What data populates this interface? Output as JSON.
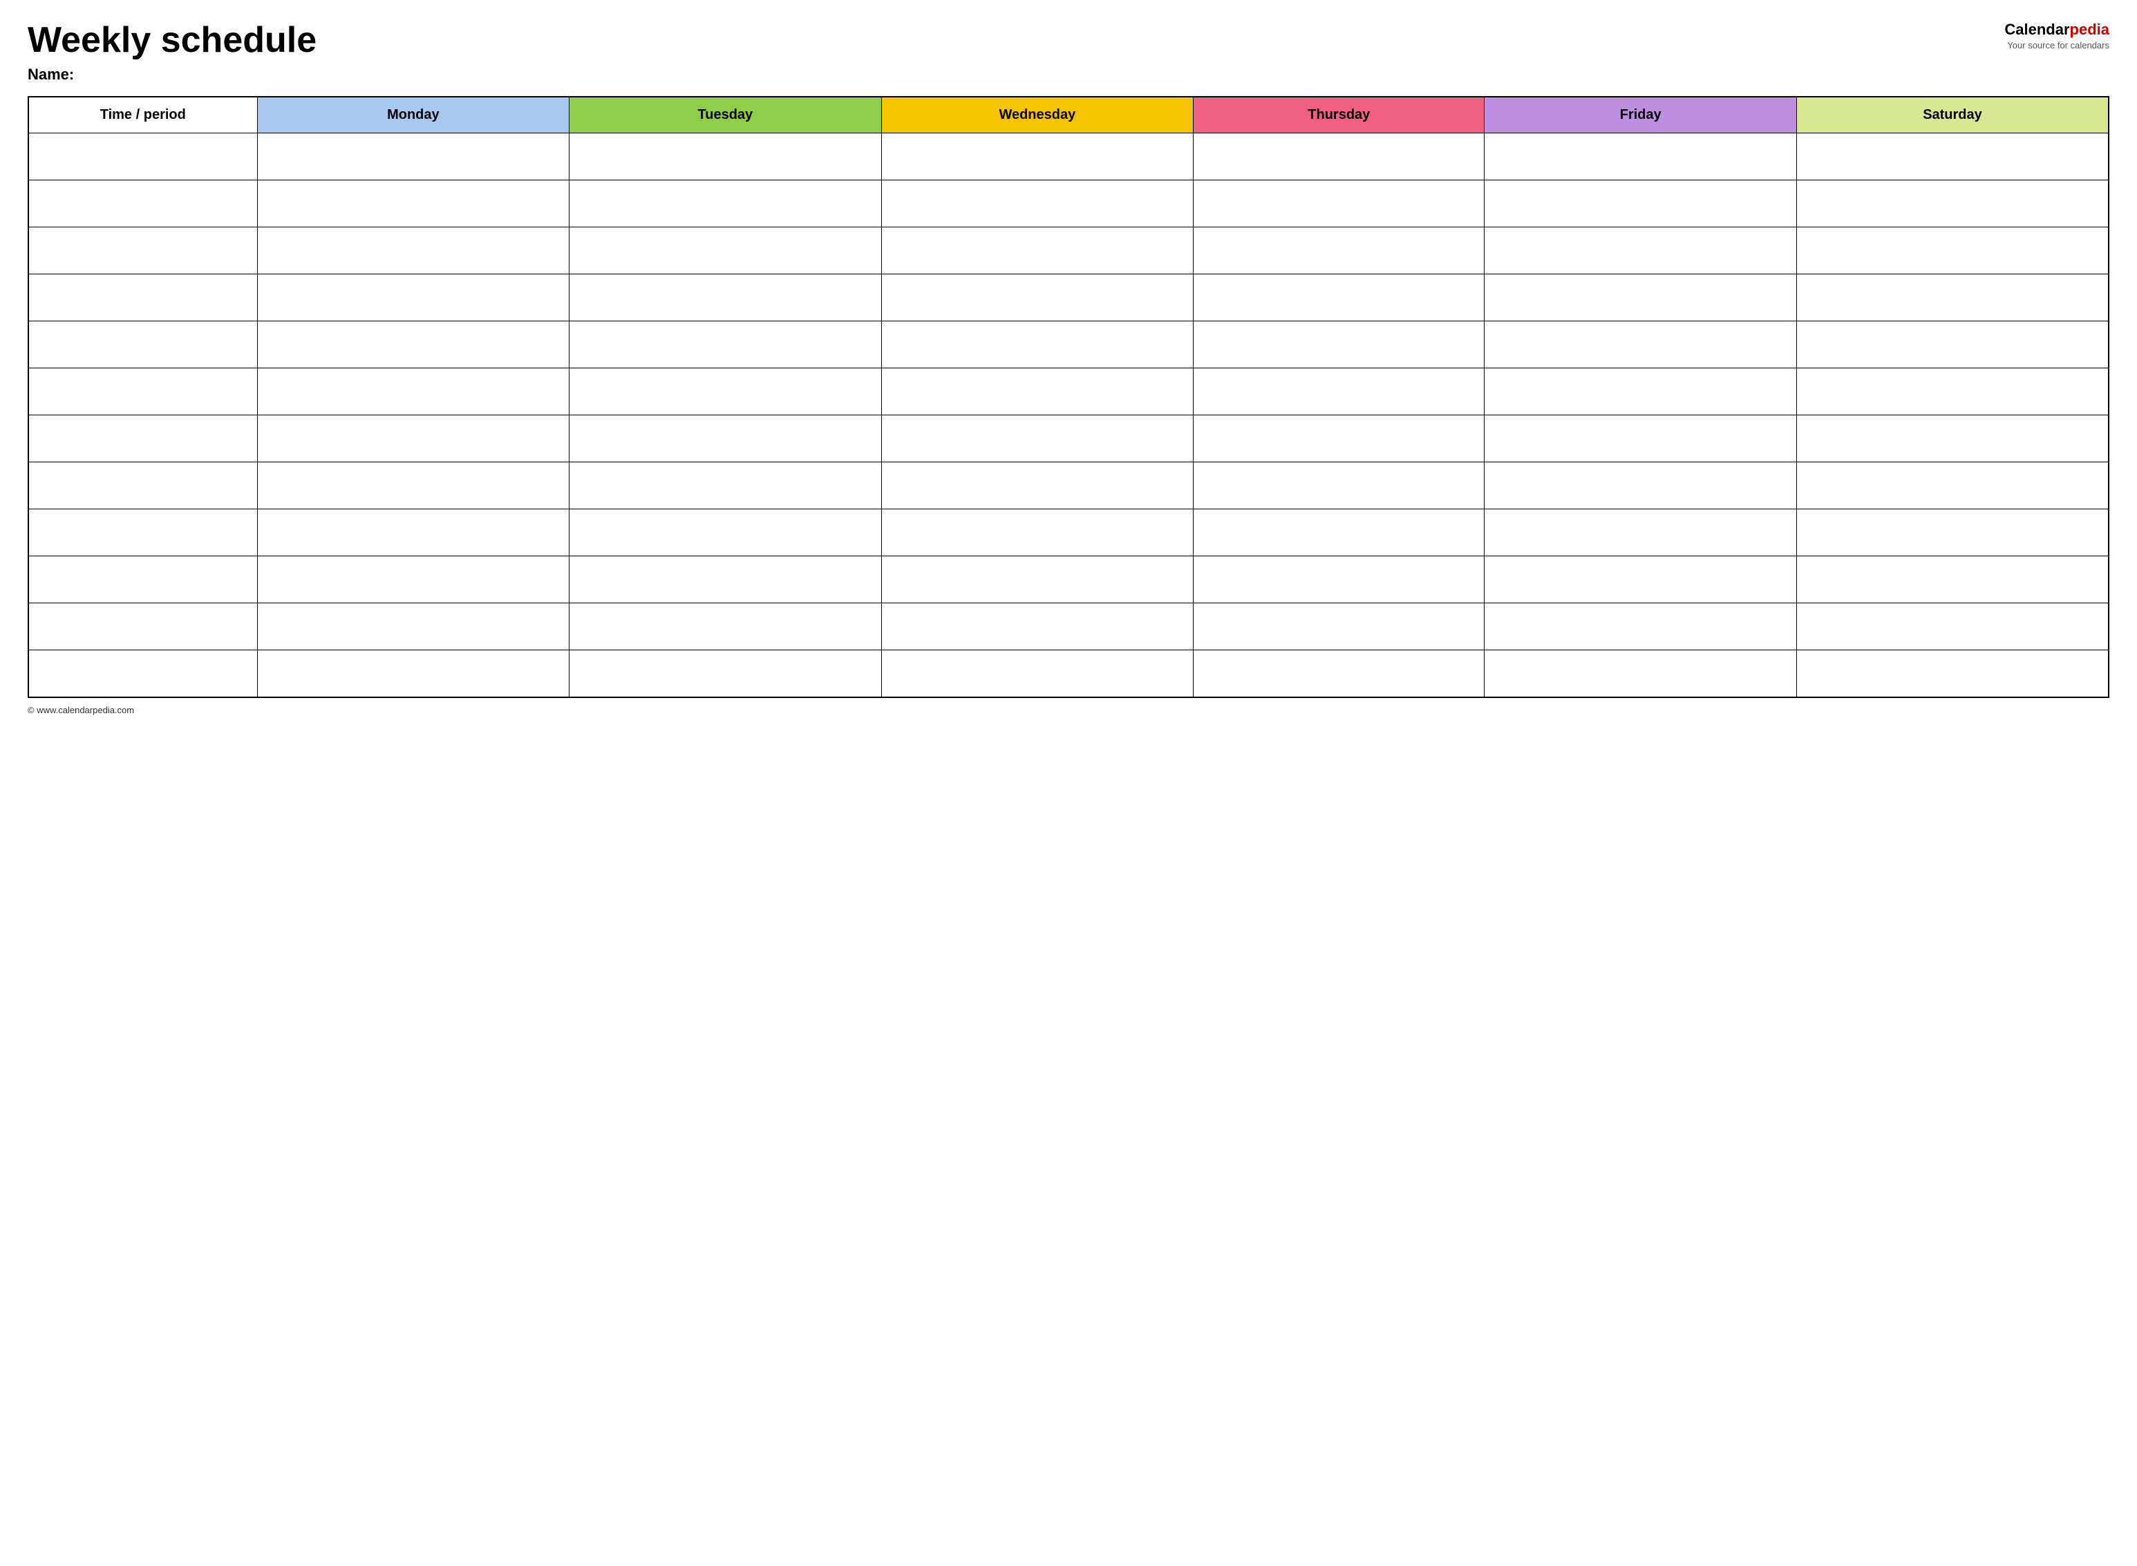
{
  "header": {
    "title": "Weekly schedule",
    "name_label": "Name:",
    "logo": {
      "calendar_part": "Calendar",
      "pedia_part": "pedia",
      "subtitle": "Your source for calendars"
    }
  },
  "table": {
    "columns": [
      {
        "key": "time",
        "label": "Time / period",
        "color": "#ffffff"
      },
      {
        "key": "monday",
        "label": "Monday",
        "color": "#a8c8f0"
      },
      {
        "key": "tuesday",
        "label": "Tuesday",
        "color": "#8fcc4a"
      },
      {
        "key": "wednesday",
        "label": "Wednesday",
        "color": "#f5c300"
      },
      {
        "key": "thursday",
        "label": "Thursday",
        "color": "#f06080"
      },
      {
        "key": "friday",
        "label": "Friday",
        "color": "#c090e0"
      },
      {
        "key": "saturday",
        "label": "Saturday",
        "color": "#d8e890"
      }
    ],
    "row_count": 12
  },
  "footer": {
    "url": "© www.calendarpedia.com"
  }
}
